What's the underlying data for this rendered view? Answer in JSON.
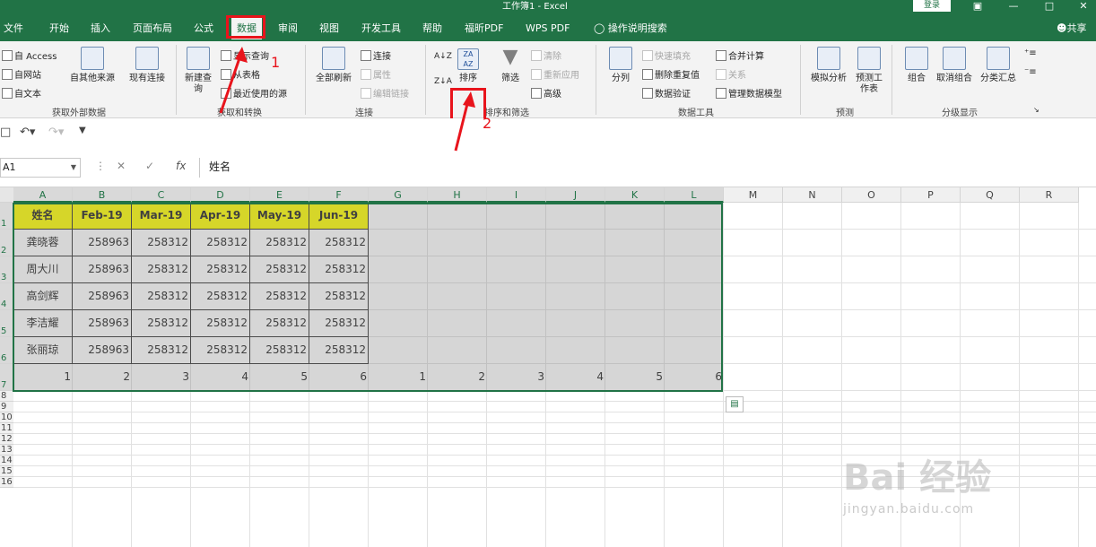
{
  "window": {
    "title": "工作簿1 - Excel",
    "login": "登录"
  },
  "tabs": [
    "文件",
    "开始",
    "插入",
    "页面布局",
    "公式",
    "数据",
    "审阅",
    "视图",
    "开发工具",
    "帮助",
    "福昕PDF",
    "WPS PDF"
  ],
  "active_tab": "数据",
  "tell_me": "操作说明搜索",
  "share": "共享",
  "ribbon": {
    "get_external": {
      "items": [
        "自 Access",
        "自网站",
        "自文本"
      ],
      "other": "自其他来源",
      "existing": "现有连接",
      "label": "获取外部数据"
    },
    "get_transform": {
      "new_query": "新建查询",
      "items": [
        "显示查询",
        "从表格",
        "最近使用的源"
      ],
      "label": "获取和转换"
    },
    "connections": {
      "refresh_all": "全部刷新",
      "items": [
        "连接",
        "属性",
        "编辑链接"
      ],
      "label": "连接"
    },
    "sort_filter": {
      "sort": "排序",
      "filter": "筛选",
      "items": [
        "清除",
        "重新应用",
        "高级"
      ],
      "label": "排序和筛选"
    },
    "data_tools": {
      "split": "分列",
      "items": [
        "快速填充",
        "删除重复值",
        "数据验证",
        "合并计算",
        "关系",
        "管理数据模型"
      ],
      "label": "数据工具"
    },
    "forecast": {
      "whatif": "模拟分析",
      "sheet": "预测工作表",
      "label": "预测"
    },
    "outline": {
      "group": "组合",
      "ungroup": "取消组合",
      "subtotal": "分类汇总",
      "label": "分级显示"
    }
  },
  "formula_bar": {
    "name_box": "A1",
    "content": "姓名"
  },
  "sheet": {
    "columns": [
      "A",
      "B",
      "C",
      "D",
      "E",
      "F",
      "G",
      "H",
      "I",
      "J",
      "K",
      "L",
      "M",
      "N",
      "O",
      "P",
      "Q",
      "R"
    ],
    "rows": [
      "1",
      "2",
      "3",
      "4",
      "5",
      "6",
      "7",
      "8",
      "9",
      "10",
      "11",
      "12",
      "13",
      "14",
      "15",
      "16"
    ],
    "header_row": [
      "姓名",
      "Feb-19",
      "Mar-19",
      "Apr-19",
      "May-19",
      "Jun-19"
    ],
    "data_rows": [
      [
        "龚晓蓉",
        "258963",
        "258312",
        "258312",
        "258312",
        "258312"
      ],
      [
        "周大川",
        "258963",
        "258312",
        "258312",
        "258312",
        "258312"
      ],
      [
        "高剑辉",
        "258963",
        "258312",
        "258312",
        "258312",
        "258312"
      ],
      [
        "李洁耀",
        "258963",
        "258312",
        "258312",
        "258312",
        "258312"
      ],
      [
        "张丽琼",
        "258963",
        "258312",
        "258312",
        "258312",
        "258312"
      ]
    ],
    "row7": [
      "1",
      "2",
      "3",
      "4",
      "5",
      "6",
      "1",
      "2",
      "3",
      "4",
      "5",
      "6"
    ]
  },
  "annotations": {
    "step1": "1",
    "step2": "2"
  },
  "watermark": {
    "brand": "Bai 经验",
    "url": "jingyan.baidu.com"
  },
  "colors": {
    "excel_green": "#217346",
    "highlight_red": "#e8141c",
    "header_yellow": "#ffff00"
  }
}
